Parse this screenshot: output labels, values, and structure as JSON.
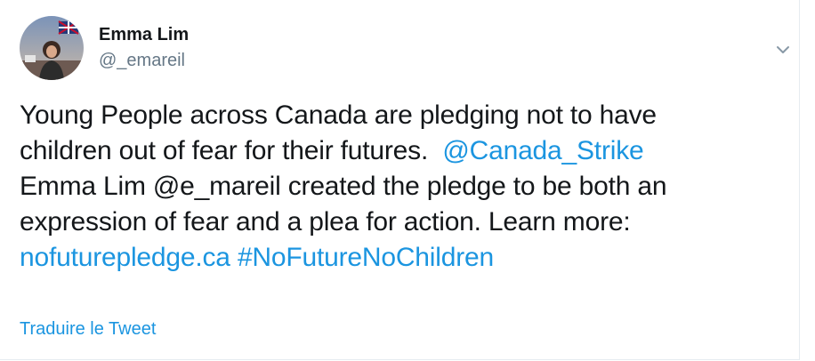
{
  "tweet": {
    "author_name": "Emma Lim",
    "author_handle": "@_emareil",
    "text_line1": "Young People across Canada are pledging not to have",
    "text_line2a": "children out of fear for their futures.  ",
    "mention": "@Canada_Strike",
    "text_line3": "Emma Lim @e_mareil created the pledge to be both an",
    "text_line4": "expression of fear and a plea for action. Learn more:",
    "url": "nofuturepledge.ca",
    "hashtag": "#NoFutureNoChildren",
    "translate_label": "Traduire le Tweet"
  },
  "colors": {
    "link": "#1b95e0",
    "text": "#14171a",
    "secondary": "#657786"
  },
  "icons": {
    "menu": "chevron-down-icon"
  }
}
